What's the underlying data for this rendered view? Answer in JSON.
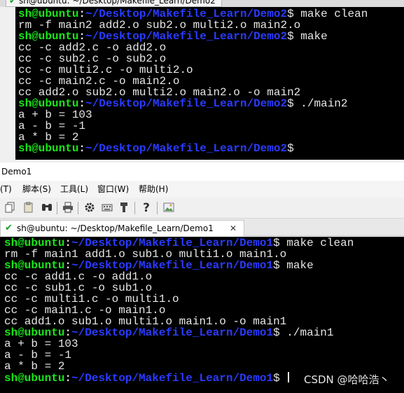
{
  "top_window": {
    "tab_label": "sh@ubuntu: ~/Desktop/Makefile_Learn/Demo2",
    "terminal_lines": [
      {
        "user": "sh@ubuntu",
        "path": "~/Desktop/Makefile_Learn/Demo2",
        "cmd": "make clean"
      },
      {
        "text": "rm -f main2 add2.o sub2.o multi2.o main2.o"
      },
      {
        "user": "sh@ubuntu",
        "path": "~/Desktop/Makefile_Learn/Demo2",
        "cmd": "make"
      },
      {
        "text": "cc -c add2.c -o add2.o"
      },
      {
        "text": "cc -c sub2.c -o sub2.o"
      },
      {
        "text": "cc -c multi2.c -o multi2.o"
      },
      {
        "text": "cc -c main2.c -o main2.o"
      },
      {
        "text": "cc add2.o sub2.o multi2.o main2.o -o main2"
      },
      {
        "user": "sh@ubuntu",
        "path": "~/Desktop/Makefile_Learn/Demo2",
        "cmd": "./main2"
      },
      {
        "text": "a + b = 103"
      },
      {
        "text": "a - b = -1"
      },
      {
        "text": "a * b = 2"
      },
      {
        "user": "sh@ubuntu",
        "path": "~/Desktop/Makefile_Learn/Demo2",
        "cmd": ""
      }
    ]
  },
  "bottom_window": {
    "title": "Demo1",
    "menu": [
      "(T)",
      "脚本(S)",
      "工具(L)",
      "窗口(W)",
      "帮助(H)"
    ],
    "toolbar_icons": [
      "copy-icon",
      "paste-icon",
      "find-icon",
      "print-icon",
      "settings-icon",
      "keymap-icon",
      "key-icon",
      "help-icon",
      "image-icon"
    ],
    "tab_label": "sh@ubuntu: ~/Desktop/Makefile_Learn/Demo1",
    "tab_close": "✕",
    "terminal_lines": [
      {
        "user": "sh@ubuntu",
        "path": "~/Desktop/Makefile_Learn/Demo1",
        "cmd": "make clean"
      },
      {
        "text": "rm -f main1 add1.o sub1.o multi1.o main1.o"
      },
      {
        "user": "sh@ubuntu",
        "path": "~/Desktop/Makefile_Learn/Demo1",
        "cmd": "make"
      },
      {
        "text": "cc -c add1.c -o add1.o"
      },
      {
        "text": "cc -c sub1.c -o sub1.o"
      },
      {
        "text": "cc -c multi1.c -o multi1.o"
      },
      {
        "text": "cc -c main1.c -o main1.o"
      },
      {
        "text": "cc add1.o sub1.o multi1.o main1.o -o main1"
      },
      {
        "user": "sh@ubuntu",
        "path": "~/Desktop/Makefile_Learn/Demo1",
        "cmd": "./main1"
      },
      {
        "text": "a + b = 103"
      },
      {
        "text": "a - b = -1"
      },
      {
        "text": "a * b = 2"
      },
      {
        "user": "sh@ubuntu",
        "path": "~/Desktop/Makefile_Learn/Demo1",
        "cmd": "",
        "cursor": true
      }
    ]
  },
  "watermark": "CSDN @哈哈浩丶",
  "colors": {
    "terminal_bg": "#000000",
    "prompt_user": "#19e619",
    "prompt_path": "#2a3bff",
    "terminal_text": "#e6e6e6"
  }
}
